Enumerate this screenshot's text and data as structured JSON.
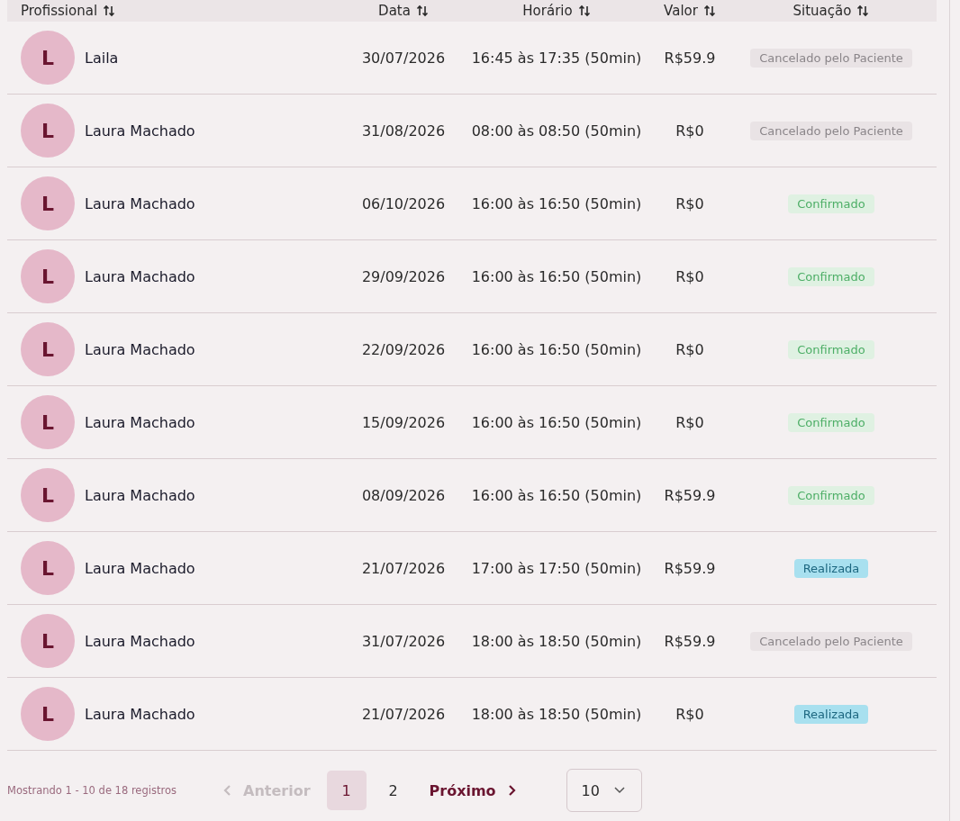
{
  "table": {
    "columns": [
      {
        "label": "Profissional"
      },
      {
        "label": "Data"
      },
      {
        "label": "Horário"
      },
      {
        "label": "Valor"
      },
      {
        "label": "Situação"
      }
    ],
    "rows": [
      {
        "initial": "L",
        "name": "Laila",
        "date": "30/07/2026",
        "time": "16:45 às 17:35 (50min)",
        "value": "R$59.9",
        "status": {
          "label": "Cancelado pelo Paciente",
          "kind": "cancelled"
        }
      },
      {
        "initial": "L",
        "name": "Laura Machado",
        "date": "31/08/2026",
        "time": "08:00 às 08:50 (50min)",
        "value": "R$0",
        "status": {
          "label": "Cancelado pelo Paciente",
          "kind": "cancelled"
        }
      },
      {
        "initial": "L",
        "name": "Laura Machado",
        "date": "06/10/2026",
        "time": "16:00 às 16:50 (50min)",
        "value": "R$0",
        "status": {
          "label": "Confirmado",
          "kind": "confirmed"
        }
      },
      {
        "initial": "L",
        "name": "Laura Machado",
        "date": "29/09/2026",
        "time": "16:00 às 16:50 (50min)",
        "value": "R$0",
        "status": {
          "label": "Confirmado",
          "kind": "confirmed"
        }
      },
      {
        "initial": "L",
        "name": "Laura Machado",
        "date": "22/09/2026",
        "time": "16:00 às 16:50 (50min)",
        "value": "R$0",
        "status": {
          "label": "Confirmado",
          "kind": "confirmed"
        }
      },
      {
        "initial": "L",
        "name": "Laura Machado",
        "date": "15/09/2026",
        "time": "16:00 às 16:50 (50min)",
        "value": "R$0",
        "status": {
          "label": "Confirmado",
          "kind": "confirmed"
        }
      },
      {
        "initial": "L",
        "name": "Laura Machado",
        "date": "08/09/2026",
        "time": "16:00 às 16:50 (50min)",
        "value": "R$59.9",
        "status": {
          "label": "Confirmado",
          "kind": "confirmed"
        }
      },
      {
        "initial": "L",
        "name": "Laura Machado",
        "date": "21/07/2026",
        "time": "17:00 às 17:50 (50min)",
        "value": "R$59.9",
        "status": {
          "label": "Realizada",
          "kind": "done"
        }
      },
      {
        "initial": "L",
        "name": "Laura Machado",
        "date": "31/07/2026",
        "time": "18:00 às 18:50 (50min)",
        "value": "R$59.9",
        "status": {
          "label": "Cancelado pelo Paciente",
          "kind": "cancelled"
        }
      },
      {
        "initial": "L",
        "name": "Laura Machado",
        "date": "21/07/2026",
        "time": "18:00 às 18:50 (50min)",
        "value": "R$0",
        "status": {
          "label": "Realizada",
          "kind": "done"
        }
      }
    ]
  },
  "footer": {
    "summary": "Mostrando 1 - 10 de 18 registros",
    "previous": {
      "label": "Anterior",
      "disabled": true
    },
    "pages": [
      {
        "label": "1",
        "selected": true
      },
      {
        "label": "2",
        "selected": false
      }
    ],
    "next": {
      "label": "Próximo",
      "disabled": false
    },
    "page_size": "10"
  }
}
